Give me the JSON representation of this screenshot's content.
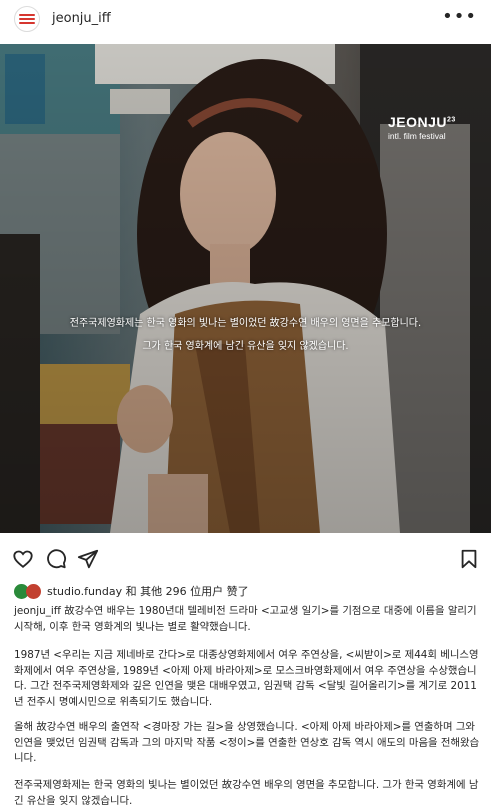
{
  "header": {
    "username": "jeonju_iff",
    "more_icon": "more-horizontal-icon"
  },
  "post_image": {
    "brand_name": "JEONJU",
    "brand_edition": "23",
    "brand_sub": "intl. film festival",
    "caption_line1": "전주국제영화제는 한국 영화의 빛나는 별이었던 故강수연 배우의 영면을 추모합니다.",
    "caption_line2": "그가 한국 영화계에 남긴 유산을 잊지 않겠습니다."
  },
  "actions": {
    "like_icon": "heart-icon",
    "comment_icon": "comment-icon",
    "share_icon": "send-icon",
    "save_icon": "bookmark-icon"
  },
  "likes": {
    "text": "studio.funday 和 其他 296 位用户 赞了"
  },
  "post_body": {
    "author": "jeonju_iff",
    "p1_rest": " 故강수연 배우는 1980년대 텔레비전 드라마 <고교생 일기>를 기점으로 대중에 이름을 알리기 시작해, 이후 한국 영화계의 빛나는 별로 활약했습니다.",
    "p2": "1987년 <우리는 지금 제네바로 간다>로 대종상영화제에서 여우 주연상을, <씨받이>로 제44회 베니스영화제에서 여우 주연상을, 1989년 <아제 아제 바라아제>로 모스크바영화제에서 여우 주연상을 수상했습니다. 그간 전주국제영화제와 깊은 인연을 맺은 대배우였고, 임권택 감독 <달빛 길어올리기>를 계기로 2011년 전주시 명예시민으로 위촉되기도 했습니다.",
    "p3": "올해 故강수연 배우의 출연작 <경마장 가는 길>을 상영했습니다. <아제 아제 바라아제>를 연출하며 그와 인연을 맺었던 임권택 감독과 그의 마지막 작품 <정이>를 연출한 연상호 감독 역시 애도의 마음을 전해왔습니다.",
    "p4": "전주국제영화제는 한국 영화의 빛나는 별이었던 故강수연 배우의 영면을 추모합니다. 그가 한국 영화계에 남긴 유산을 잊지 않겠습니다."
  }
}
